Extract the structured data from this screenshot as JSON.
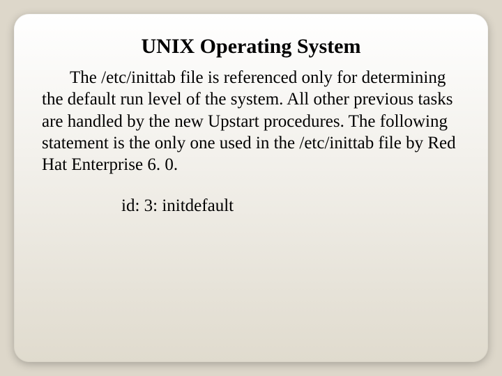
{
  "slide": {
    "title": "UNIX Operating System",
    "body": "The /etc/inittab file is referenced only for determining the default run level of the system. All other previous tasks are handled by the new Upstart procedures. The following statement is the only one used in the /etc/inittab file by Red Hat Enterprise 6. 0.",
    "code": "id: 3: initdefault"
  }
}
